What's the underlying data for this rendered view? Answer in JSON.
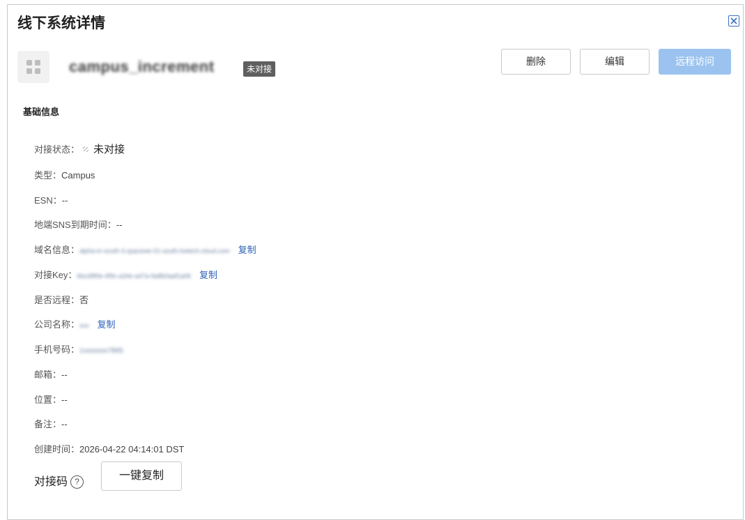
{
  "dialog": {
    "title": "线下系统详情"
  },
  "header": {
    "system_name": "campus_increment",
    "status_badge": "未对接",
    "buttons": {
      "delete": "删除",
      "edit": "编辑",
      "remote": "远程访问"
    }
  },
  "section": {
    "title": "基础信息"
  },
  "fields": {
    "status": {
      "label": "对接状态：",
      "value": "未对接"
    },
    "type": {
      "label": "类型：",
      "value": "Campus"
    },
    "esn": {
      "label": "ESN：",
      "value": "--"
    },
    "sns": {
      "label": "地端SNS到期时间：",
      "value": "--"
    },
    "domain": {
      "label": "域名信息：",
      "value": "alpha-in-south-3.spacewe-01-south.hwtech.cloud.com",
      "copy": "复制"
    },
    "key": {
      "label": "对接Key：",
      "value": "6bcd9f0e-4f9c-a34e-a47a-9a8b0aaf1a06",
      "copy": "复制"
    },
    "remote": {
      "label": "是否远程：",
      "value": "否"
    },
    "company": {
      "label": "公司名称：",
      "value": "xxx",
      "copy": "复制"
    },
    "phone": {
      "label": "手机号码：",
      "value": "1xxxxxxx7865"
    },
    "email": {
      "label": "邮箱：",
      "value": "--"
    },
    "location": {
      "label": "位置：",
      "value": "--"
    },
    "remark": {
      "label": "备注：",
      "value": "--"
    },
    "created": {
      "label": "创建时间：",
      "value": "2026-04-22 04:14:01 DST"
    }
  },
  "code": {
    "label": "对接码",
    "help": "?",
    "copy_all": "一键复制"
  },
  "icons": {
    "close": "close-icon",
    "app": "grid-icon",
    "status": "unlink-icon",
    "help": "help-icon"
  }
}
